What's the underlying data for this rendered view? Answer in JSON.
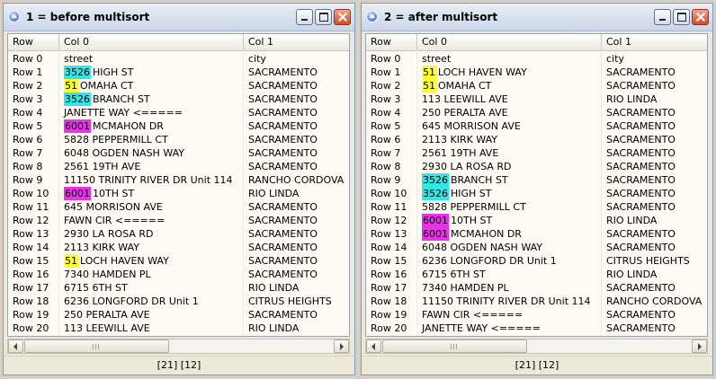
{
  "colors": {
    "cyan": "#33e6e6",
    "yellow": "#ffff33",
    "magenta": "#e633e6"
  },
  "windows": [
    {
      "title": "1 = before multisort",
      "columns": [
        "Row",
        "Col 0",
        "Col 1"
      ],
      "status": "[21] [12]",
      "rows": [
        {
          "row": "Row 0",
          "num": "",
          "hl": "",
          "street": "street",
          "city": "city"
        },
        {
          "row": "Row 1",
          "num": "3526",
          "hl": "cyan",
          "street": "HIGH ST",
          "city": "SACRAMENTO"
        },
        {
          "row": "Row 2",
          "num": "51",
          "hl": "yellow",
          "street": "OMAHA CT",
          "city": "SACRAMENTO"
        },
        {
          "row": "Row 3",
          "num": "3526",
          "hl": "cyan",
          "street": "BRANCH ST",
          "city": "SACRAMENTO"
        },
        {
          "row": "Row 4",
          "num": "",
          "hl": "",
          "street": "JANETTE WAY <=====",
          "city": "SACRAMENTO"
        },
        {
          "row": "Row 5",
          "num": "6001",
          "hl": "magenta",
          "street": "MCMAHON DR",
          "city": "SACRAMENTO"
        },
        {
          "row": "Row 6",
          "num": "",
          "hl": "",
          "street": "5828 PEPPERMILL CT",
          "city": "SACRAMENTO"
        },
        {
          "row": "Row 7",
          "num": "",
          "hl": "",
          "street": "6048 OGDEN NASH WAY",
          "city": "SACRAMENTO"
        },
        {
          "row": "Row 8",
          "num": "",
          "hl": "",
          "street": "2561 19TH AVE",
          "city": "SACRAMENTO"
        },
        {
          "row": "Row 9",
          "num": "",
          "hl": "",
          "street": "11150 TRINITY RIVER DR Unit 114",
          "city": "RANCHO CORDOVA"
        },
        {
          "row": "Row 10",
          "num": "6001",
          "hl": "magenta",
          "street": "10TH ST",
          "city": "RIO LINDA"
        },
        {
          "row": "Row 11",
          "num": "",
          "hl": "",
          "street": "645 MORRISON AVE",
          "city": "SACRAMENTO"
        },
        {
          "row": "Row 12",
          "num": "",
          "hl": "",
          "street": "FAWN CIR <=====",
          "city": "SACRAMENTO"
        },
        {
          "row": "Row 13",
          "num": "",
          "hl": "",
          "street": "2930 LA ROSA RD",
          "city": "SACRAMENTO"
        },
        {
          "row": "Row 14",
          "num": "",
          "hl": "",
          "street": "2113 KIRK WAY",
          "city": "SACRAMENTO"
        },
        {
          "row": "Row 15",
          "num": "51",
          "hl": "yellow",
          "street": "LOCH HAVEN WAY",
          "city": "SACRAMENTO"
        },
        {
          "row": "Row 16",
          "num": "",
          "hl": "",
          "street": "7340 HAMDEN PL",
          "city": "SACRAMENTO"
        },
        {
          "row": "Row 17",
          "num": "",
          "hl": "",
          "street": "6715 6TH ST",
          "city": "RIO LINDA"
        },
        {
          "row": "Row 18",
          "num": "",
          "hl": "",
          "street": "6236 LONGFORD DR Unit 1",
          "city": "CITRUS HEIGHTS"
        },
        {
          "row": "Row 19",
          "num": "",
          "hl": "",
          "street": "250 PERALTA AVE",
          "city": "SACRAMENTO"
        },
        {
          "row": "Row 20",
          "num": "",
          "hl": "",
          "street": "113 LEEWILL AVE",
          "city": "RIO LINDA"
        }
      ]
    },
    {
      "title": "2 = after multisort",
      "columns": [
        "Row",
        "Col 0",
        "Col 1"
      ],
      "status": "[21] [12]",
      "rows": [
        {
          "row": "Row 0",
          "num": "",
          "hl": "",
          "street": "street",
          "city": "city"
        },
        {
          "row": "Row 1",
          "num": "51",
          "hl": "yellow",
          "street": "LOCH HAVEN WAY",
          "city": "SACRAMENTO"
        },
        {
          "row": "Row 2",
          "num": "51",
          "hl": "yellow",
          "street": "OMAHA CT",
          "city": "SACRAMENTO"
        },
        {
          "row": "Row 3",
          "num": "",
          "hl": "",
          "street": "113 LEEWILL AVE",
          "city": "RIO LINDA"
        },
        {
          "row": "Row 4",
          "num": "",
          "hl": "",
          "street": "250 PERALTA AVE",
          "city": "SACRAMENTO"
        },
        {
          "row": "Row 5",
          "num": "",
          "hl": "",
          "street": "645 MORRISON AVE",
          "city": "SACRAMENTO"
        },
        {
          "row": "Row 6",
          "num": "",
          "hl": "",
          "street": "2113 KIRK WAY",
          "city": "SACRAMENTO"
        },
        {
          "row": "Row 7",
          "num": "",
          "hl": "",
          "street": "2561 19TH AVE",
          "city": "SACRAMENTO"
        },
        {
          "row": "Row 8",
          "num": "",
          "hl": "",
          "street": "2930 LA ROSA RD",
          "city": "SACRAMENTO"
        },
        {
          "row": "Row 9",
          "num": "3526",
          "hl": "cyan",
          "street": "BRANCH ST",
          "city": "SACRAMENTO"
        },
        {
          "row": "Row 10",
          "num": "3526",
          "hl": "cyan",
          "street": "HIGH ST",
          "city": "SACRAMENTO"
        },
        {
          "row": "Row 11",
          "num": "",
          "hl": "",
          "street": "5828 PEPPERMILL CT",
          "city": "SACRAMENTO"
        },
        {
          "row": "Row 12",
          "num": "6001",
          "hl": "magenta",
          "street": "10TH ST",
          "city": "RIO LINDA"
        },
        {
          "row": "Row 13",
          "num": "6001",
          "hl": "magenta",
          "street": "MCMAHON DR",
          "city": "SACRAMENTO"
        },
        {
          "row": "Row 14",
          "num": "",
          "hl": "",
          "street": "6048 OGDEN NASH WAY",
          "city": "SACRAMENTO"
        },
        {
          "row": "Row 15",
          "num": "",
          "hl": "",
          "street": "6236 LONGFORD DR Unit 1",
          "city": "CITRUS HEIGHTS"
        },
        {
          "row": "Row 16",
          "num": "",
          "hl": "",
          "street": "6715 6TH ST",
          "city": "RIO LINDA"
        },
        {
          "row": "Row 17",
          "num": "",
          "hl": "",
          "street": "7340 HAMDEN PL",
          "city": "SACRAMENTO"
        },
        {
          "row": "Row 18",
          "num": "",
          "hl": "",
          "street": "11150 TRINITY RIVER DR Unit 114",
          "city": "RANCHO CORDOVA"
        },
        {
          "row": "Row 19",
          "num": "",
          "hl": "",
          "street": "FAWN CIR <=====",
          "city": "SACRAMENTO"
        },
        {
          "row": "Row 20",
          "num": "",
          "hl": "",
          "street": "JANETTE WAY <=====",
          "city": "SACRAMENTO"
        }
      ]
    }
  ]
}
